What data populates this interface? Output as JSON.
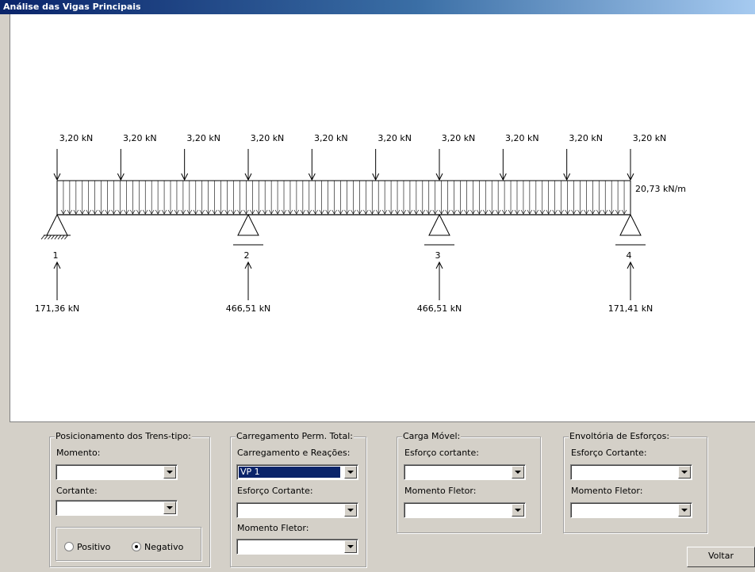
{
  "window": {
    "title": "Análise das Vigas Principais"
  },
  "diagram": {
    "point_loads": [
      "3,20 kN",
      "3,20 kN",
      "3,20 kN",
      "3,20 kN",
      "3,20 kN",
      "3,20 kN",
      "3,20 kN",
      "3,20 kN",
      "3,20 kN",
      "3,20 kN"
    ],
    "distributed_load": "20,73 kN/m",
    "supports": [
      {
        "label": "1",
        "reaction": "171,36 kN"
      },
      {
        "label": "2",
        "reaction": "466,51 kN"
      },
      {
        "label": "3",
        "reaction": "466,51 kN"
      },
      {
        "label": "4",
        "reaction": "171,41 kN"
      }
    ]
  },
  "panels": {
    "trens": {
      "title": "Posicionamento dos Trens-tipo:",
      "momento_label": "Momento:",
      "cortante_label": "Cortante:",
      "momento_value": "",
      "cortante_value": "",
      "radio_positivo": "Positivo",
      "radio_negativo": "Negativo",
      "selected": "Negativo"
    },
    "perm": {
      "title": "Carregamento Perm. Total:",
      "carregamento_label": "Carregamento e Reações:",
      "carregamento_value": "VP 1",
      "cortante_label": "Esforço Cortante:",
      "cortante_value": "",
      "momento_label": "Momento Fletor:",
      "momento_value": ""
    },
    "movel": {
      "title": "Carga Móvel:",
      "cortante_label": "Esforço cortante:",
      "cortante_value": "",
      "momento_label": "Momento Fletor:",
      "momento_value": ""
    },
    "envoltoria": {
      "title": "Envoltória de Esforços:",
      "cortante_label": "Esforço Cortante:",
      "cortante_value": "",
      "momento_label": "Momento Fletor:",
      "momento_value": ""
    }
  },
  "buttons": {
    "voltar": "Voltar"
  }
}
